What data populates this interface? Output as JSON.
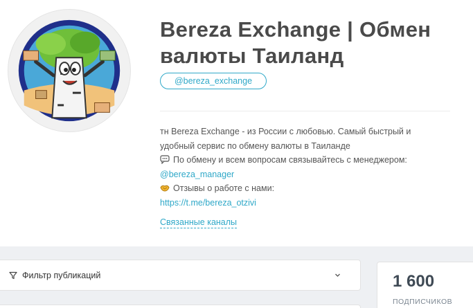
{
  "channel": {
    "title": "Bereza Exchange | Обмен валюты Таиланд",
    "username": "@bereza_exchange",
    "avatar_icon": "birch-tree-mascot-icon",
    "description": {
      "line1": "тн Bereza Exchange - из России с любовью. Самый быстрый и",
      "line2": "удобный сервис по обмену валюты в Таиланде",
      "line3": "По обмену и всем вопросам связывайтесь с менеджером:",
      "manager_link": "@bereza_manager",
      "line5": "Отзывы о работе с нами:",
      "reviews_link": "https://t.me/bereza_otzivi"
    },
    "related_channels_label": "Связанные каналы"
  },
  "filter": {
    "label": "Фильтр публикаций",
    "icon": "funnel-icon",
    "chevron_icon": "chevron-down-icon"
  },
  "stats": {
    "subscribers_value": "1 600",
    "subscribers_label": "ПОДПИСЧИКОВ"
  },
  "colors": {
    "accent": "#2fa8c8",
    "title": "#4a4a4a",
    "background": "#eef0f3"
  }
}
